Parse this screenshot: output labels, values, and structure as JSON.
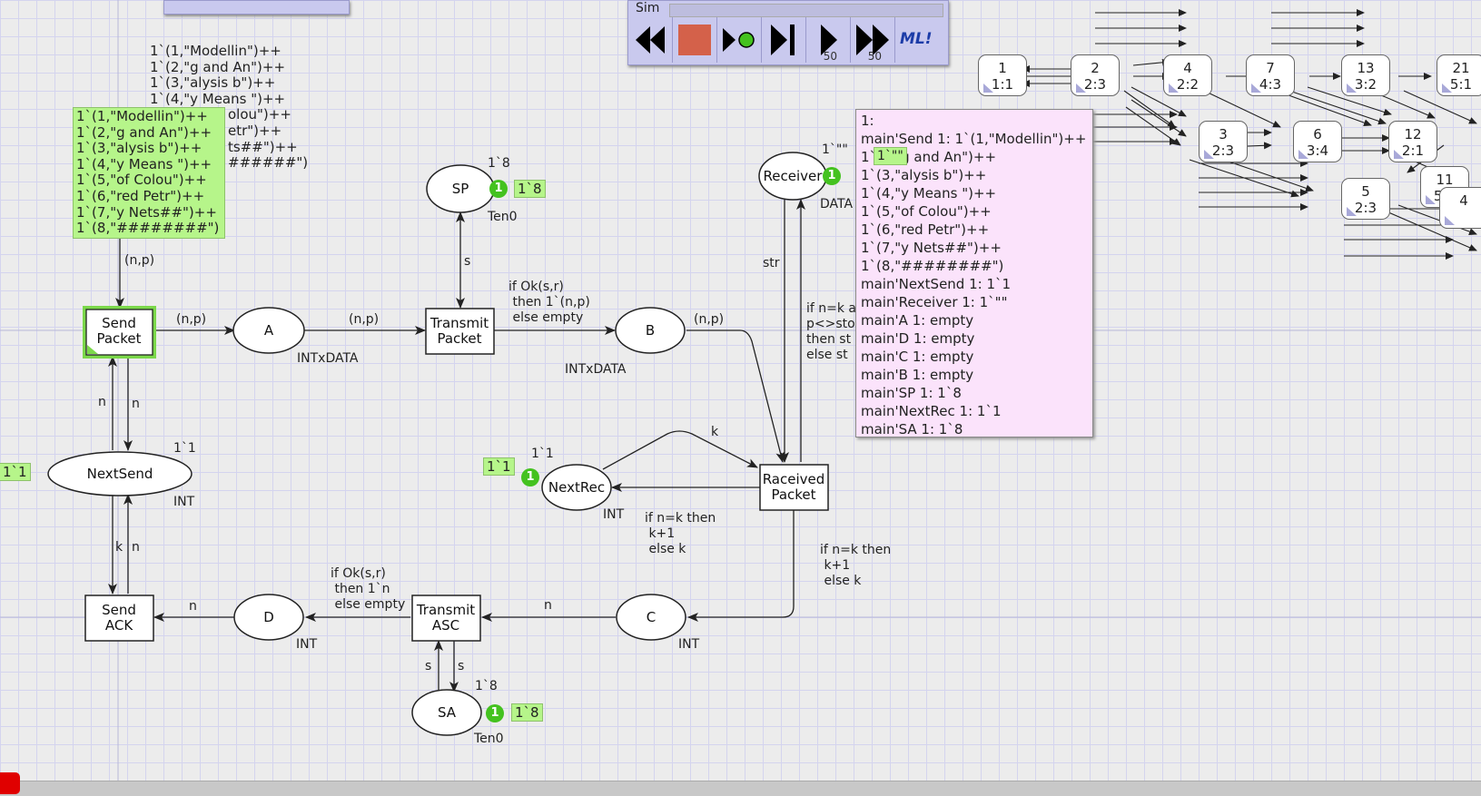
{
  "simulation_toolbar": {
    "title": "Sim",
    "buttons": [
      {
        "name": "rewind",
        "label": ""
      },
      {
        "name": "stop",
        "label": ""
      },
      {
        "name": "play-single",
        "label": ""
      },
      {
        "name": "step-end",
        "label": ""
      },
      {
        "name": "play-50",
        "label": "50"
      },
      {
        "name": "fast-forward-50",
        "label": "50"
      },
      {
        "name": "ml",
        "label": "ML!"
      }
    ]
  },
  "places": {
    "sp": {
      "name": "SP",
      "type": "Ten0",
      "initial": "1`8",
      "token_count": "1",
      "marking": "1`8"
    },
    "a": {
      "name": "A",
      "type": "INTxDATA"
    },
    "b": {
      "name": "B",
      "type": "INTxDATA"
    },
    "receiver": {
      "name": "Receiver",
      "initial": "1`\"\"",
      "type": "DATA",
      "token_count": "1",
      "marking": "1`\"\""
    },
    "nextsend": {
      "name": "NextSend",
      "initial": "1`1",
      "type": "INT",
      "marking_left": "1`1"
    },
    "nextrec": {
      "name": "NextRec",
      "initial": "1`1",
      "type": "INT",
      "token_count": "1",
      "marking": "1`1"
    },
    "d": {
      "name": "D",
      "type": "INT"
    },
    "c": {
      "name": "C",
      "type": "INT"
    },
    "sa": {
      "name": "SA",
      "initial": "1`8",
      "type": "Ten0",
      "token_count": "1",
      "marking": "1`8"
    },
    "send_packet_marking": [
      "1`(1,\"Modellin\")++",
      "1`(2,\"g and An\")++",
      "1`(3,\"alysis b\")++",
      "1`(4,\"y Means \")++",
      "1`(5,\"of Colou\")++",
      "1`(6,\"red Petr\")++",
      "1`(7,\"y Nets##\")++",
      "1`(8,\"########\")"
    ],
    "send_packet_bg_visible": [
      "1`(1,\"Modellin\")++",
      "1`(2,\"g and An\")++",
      "1`(3,\"alysis b\")++",
      "1`(4,\"y Means \")++",
      "olou\")++",
      "etr\")++",
      "ts##\")++",
      "######\")"
    ]
  },
  "transitions": {
    "send_packet": "Send\nPacket",
    "transmit_packet": "Transmit\nPacket",
    "received_packet": "Raceived\nPacket",
    "send_ack": "Send\nACK",
    "transmit_ack": "Transmit\nASC"
  },
  "arc_labels": {
    "np1": "(n,p)",
    "np2": "(n,p)",
    "np3": "(n,p)",
    "np4": "(n,p)",
    "transmit_packet_out": [
      "if Ok(s,r)",
      " then 1`(n,p)",
      " else empty"
    ],
    "s1": "s",
    "s2": "s",
    "s3": "s",
    "n1": "n",
    "n2": "n",
    "n3": "n",
    "n4": "n",
    "n5": "n",
    "k1": "k",
    "k2": "k",
    "str": "str",
    "received_cond": [
      "if n=k a",
      "p<>sto",
      "then st",
      "else st"
    ],
    "nextrec_cond": [
      "if n=k then",
      " k+1",
      " else k"
    ],
    "c_cond": [
      "if n=k then",
      " k+1",
      " else k"
    ],
    "transmit_ack_out": [
      "if Ok(s,r)",
      " then 1`n",
      " else empty"
    ]
  },
  "state_tooltip": [
    "1:",
    "main'Send 1: 1`(1,\"Modellin\")++",
    "1`(2,\"g and An\")++",
    "1`(3,\"alysis b\")++",
    "1`(4,\"y Means \")++",
    "1`(5,\"of Colou\")++",
    "1`(6,\"red Petr\")++",
    "1`(7,\"y Nets##\")++",
    "1`(8,\"########\")",
    "main'NextSend 1: 1`1",
    "main'Receiver 1: 1`\"\"",
    "main'A 1: empty",
    "main'D 1: empty",
    "main'C 1: empty",
    "main'B 1: empty",
    "main'SP 1: 1`8",
    "main'NextRec 1: 1`1",
    "main'SA 1: 1`8"
  ],
  "receiver_overlay_token": "1`\"\"",
  "state_space_nodes": [
    {
      "id": "1",
      "info": "1:1"
    },
    {
      "id": "2",
      "info": "2:3"
    },
    {
      "id": "4",
      "info": "2:2"
    },
    {
      "id": "7",
      "info": "4:3"
    },
    {
      "id": "13",
      "info": "3:2"
    },
    {
      "id": "21",
      "info": "5:1"
    },
    {
      "id": "3",
      "info": "2:3"
    },
    {
      "id": "6",
      "info": "3:4"
    },
    {
      "id": "12",
      "info": "2:1"
    },
    {
      "id": "11",
      "info": "5:5"
    },
    {
      "id": "5",
      "info": "2:3"
    },
    {
      "id": "",
      "info": "4"
    }
  ],
  "colors": {
    "token_green": "#44c21f",
    "marking_green": "#b6f58a",
    "tooltip_pink": "#fbe3fb",
    "toolbar_lavender": "#c9c9ee",
    "stop_red": "#d4614a",
    "enabled_green": "#7bd84a"
  }
}
